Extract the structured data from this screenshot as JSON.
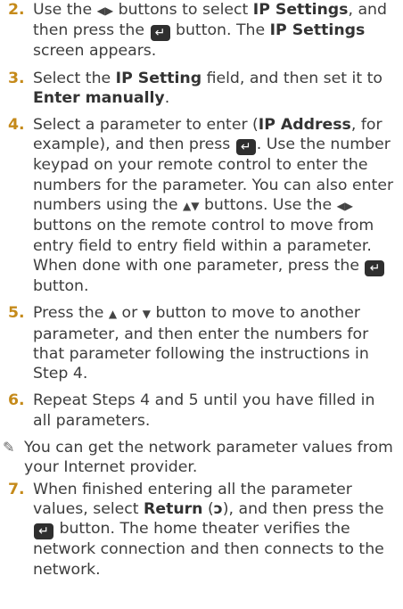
{
  "steps": [
    {
      "num": "2.",
      "text": [
        {
          "t": "Use the "
        },
        {
          "g": "lr",
          "name": "left-right-arrows-icon",
          "txt": "◀▶"
        },
        {
          "t": " buttons to select "
        },
        {
          "b": "IP Settings"
        },
        {
          "t": ", and then press the "
        },
        {
          "e": true
        },
        {
          "t": " button. The "
        },
        {
          "b": "IP Settings"
        },
        {
          "t": " screen appears."
        }
      ]
    },
    {
      "num": "3.",
      "text": [
        {
          "t": "Select the "
        },
        {
          "b": "IP Setting"
        },
        {
          "t": " field, and then set it to "
        },
        {
          "b": "Enter manually"
        },
        {
          "t": "."
        }
      ]
    },
    {
      "num": "4.",
      "text": [
        {
          "t": "Select a parameter to enter ("
        },
        {
          "b": "IP Address"
        },
        {
          "t": ", for example), and then press "
        },
        {
          "e": true
        },
        {
          "t": ". Use the number keypad on your remote control to enter the numbers for the parameter. You can also enter numbers using the "
        },
        {
          "g": "ud",
          "name": "up-down-arrows-icon",
          "txt": "▲▼"
        },
        {
          "t": " buttons. Use the "
        },
        {
          "g": "lr",
          "name": "left-right-arrows-icon",
          "txt": "◀▶"
        },
        {
          "t": " buttons on the remote control to move from entry field to entry field within a parameter. When done with one parameter, press the "
        },
        {
          "e": true
        },
        {
          "t": " button."
        }
      ]
    },
    {
      "num": "5.",
      "text": [
        {
          "t": "Press the "
        },
        {
          "g": "u",
          "name": "up-arrow-icon",
          "txt": "▲"
        },
        {
          "t": " or "
        },
        {
          "g": "d",
          "name": "down-arrow-icon",
          "txt": "▼"
        },
        {
          "t": " button to move to another parameter, and then enter the numbers for that parameter following the instructions in Step 4."
        }
      ]
    },
    {
      "num": "6.",
      "text": [
        {
          "t": "Repeat Steps 4 and 5 until you have filled in all parameters."
        }
      ]
    }
  ],
  "note": {
    "icon": "✎",
    "text": "You can get the network parameter values from your Internet provider."
  },
  "final_step": {
    "num": "7.",
    "text": [
      {
        "t": "When finished entering all the parameter values, select "
      },
      {
        "b": "Return"
      },
      {
        "t": " ("
      },
      {
        "g": "ret",
        "name": "return-icon",
        "txt": "ↄ"
      },
      {
        "t": "), and then press the "
      },
      {
        "e": true
      },
      {
        "t": " button. The home theater verifies the network connection and then connects to the network."
      }
    ]
  },
  "enter_icon_glyph": "↵"
}
